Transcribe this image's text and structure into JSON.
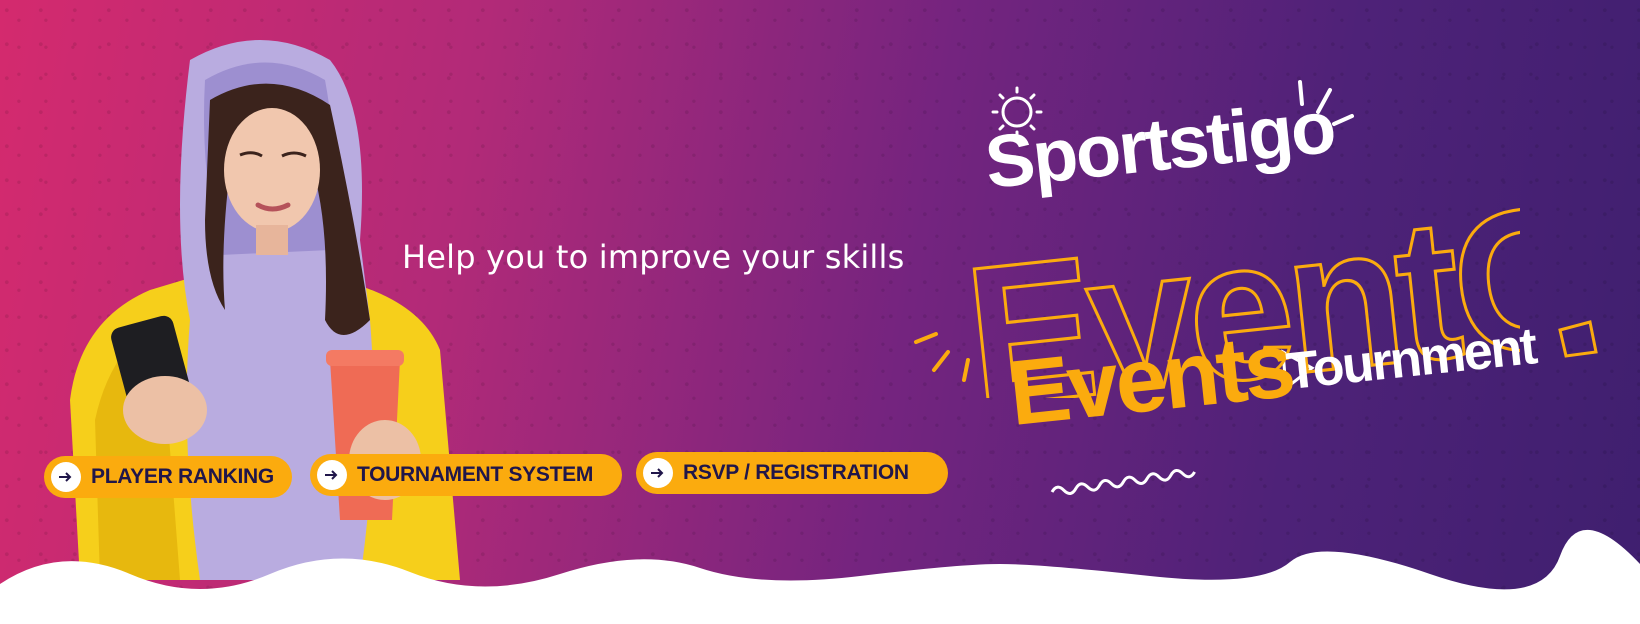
{
  "tagline": "Help you to improve your skills",
  "buttons": [
    {
      "label": "PLAYER RANKING",
      "icon": "arrow-right-icon"
    },
    {
      "label": "TOURNAMENT SYSTEM",
      "icon": "arrow-right-icon"
    },
    {
      "label": "RSVP / REGISTRATION",
      "icon": "arrow-right-icon"
    }
  ],
  "logo": {
    "brand": "Sportstigo",
    "product": "EventGO",
    "events": "Events",
    "tournament": "Tournment"
  },
  "colors": {
    "gradient_start": "#d42a6e",
    "gradient_end": "#3f1f6f",
    "accent_yellow": "#fbab0e",
    "button_text": "#20164a",
    "white": "#ffffff"
  }
}
